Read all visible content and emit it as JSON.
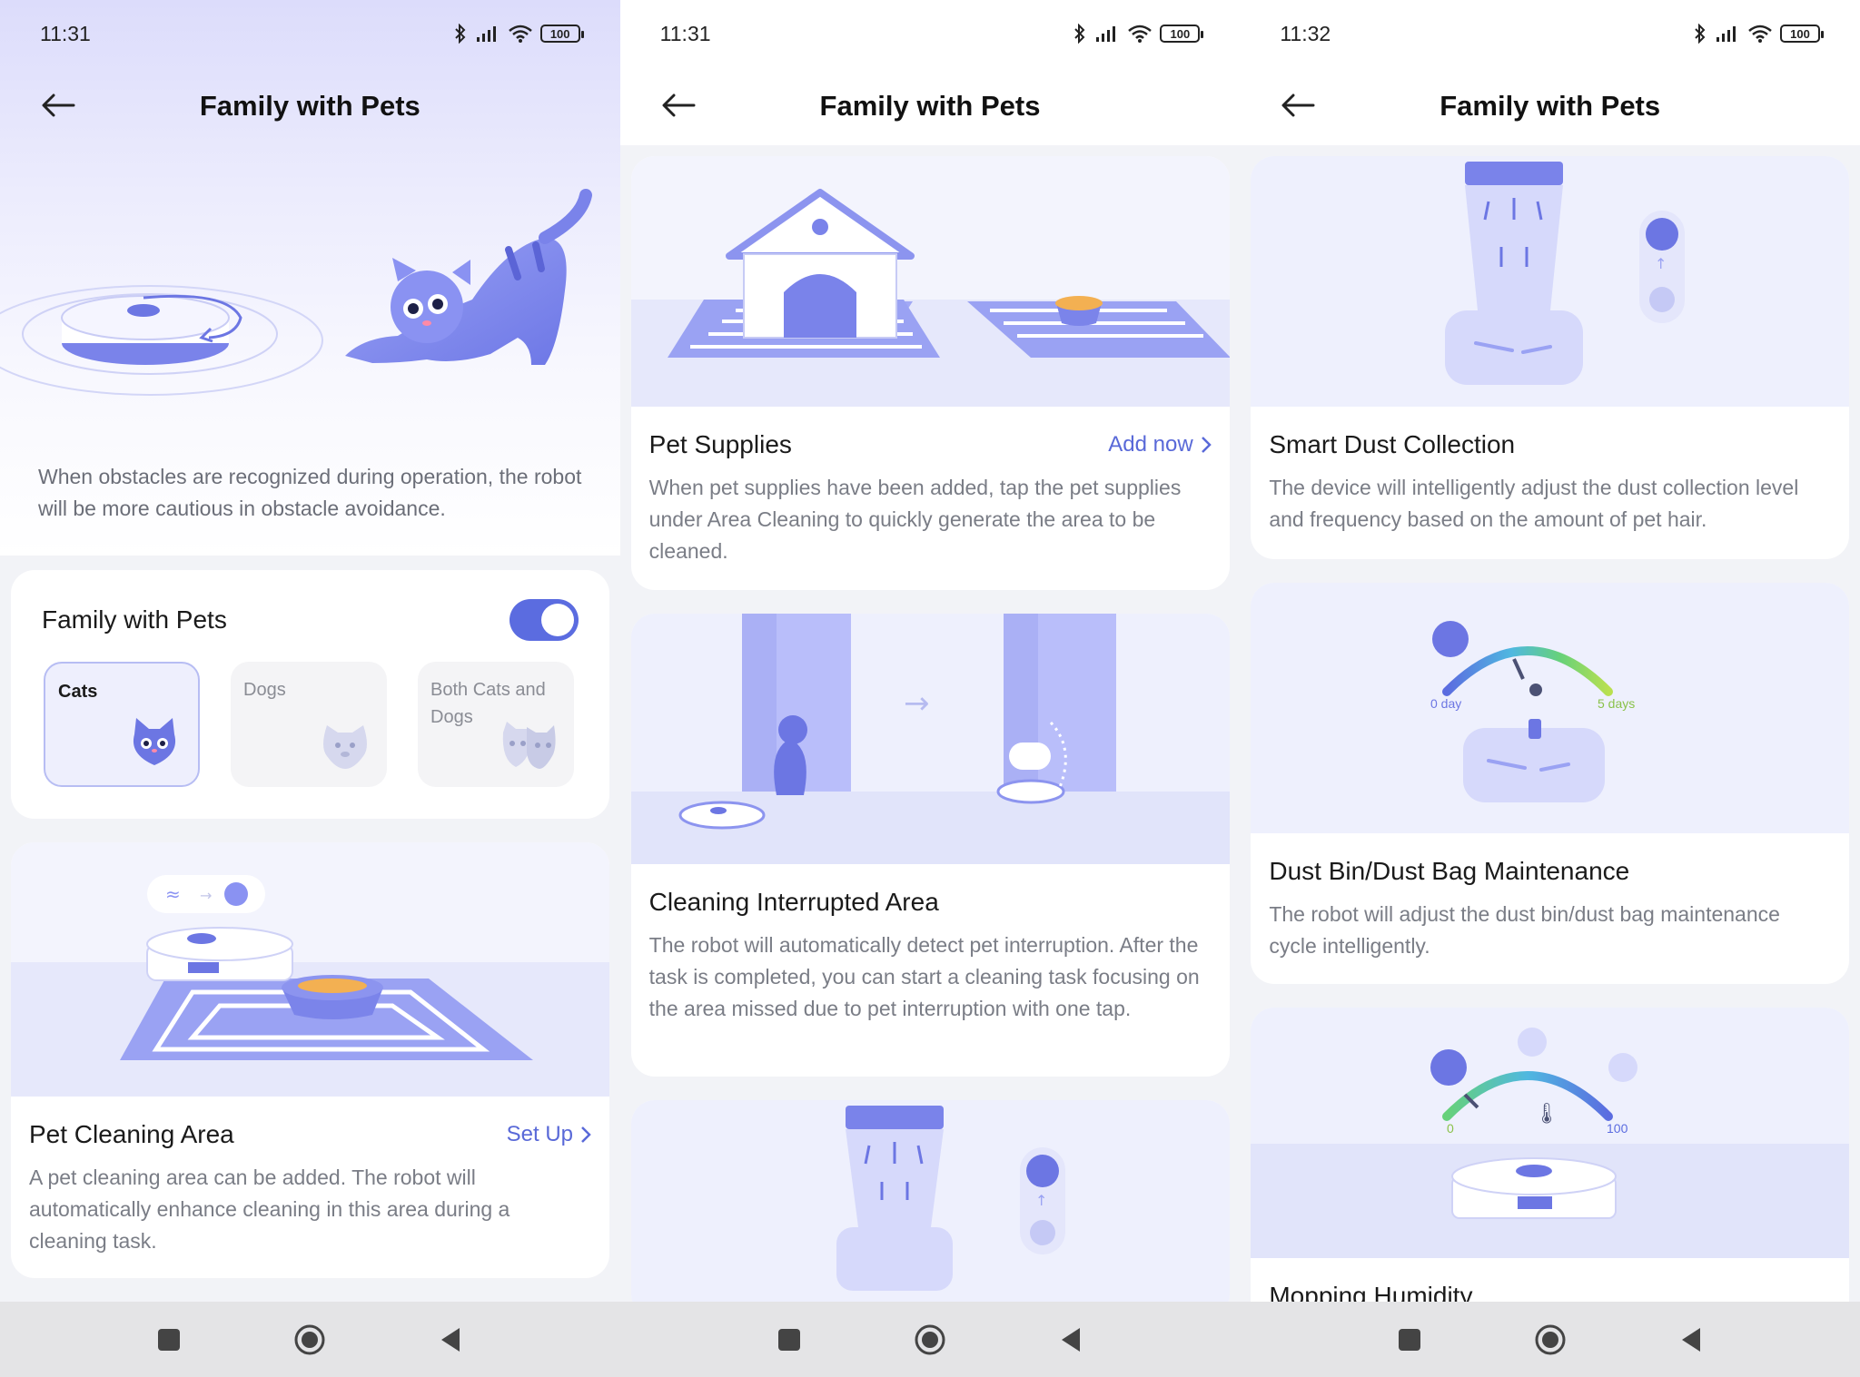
{
  "screens": [
    {
      "status": {
        "time": "11:31",
        "battery": "100"
      },
      "nav": {
        "title": "Family with Pets"
      },
      "hero": {
        "description": "When obstacles are recognized during operation, the robot will be more cautious in obstacle avoidance."
      },
      "toggle_card": {
        "label": "Family with Pets",
        "enabled": true,
        "options": [
          {
            "label": "Cats",
            "selected": true
          },
          {
            "label": "Dogs",
            "selected": false
          },
          {
            "label": "Both Cats and Dogs",
            "selected": false
          }
        ]
      },
      "pet_cleaning": {
        "title": "Pet Cleaning Area",
        "action": "Set Up",
        "description": "A pet cleaning area can be added. The robot will automatically enhance cleaning in this area during a cleaning task."
      }
    },
    {
      "status": {
        "time": "11:31",
        "battery": "100"
      },
      "nav": {
        "title": "Family with Pets"
      },
      "pet_supplies": {
        "title": "Pet Supplies",
        "action": "Add now",
        "description": "When pet supplies have been added, tap the pet supplies under Area Cleaning to quickly generate the area to be cleaned."
      },
      "interrupted": {
        "title": "Cleaning Interrupted Area",
        "description": "The robot will automatically detect pet interruption. After the task is completed, you can start a cleaning task focusing on the area missed due to pet interruption with one tap."
      }
    },
    {
      "status": {
        "time": "11:32",
        "battery": "100"
      },
      "nav": {
        "title": "Family with Pets"
      },
      "dust_collection": {
        "title": "Smart Dust Collection",
        "description": "The device will intelligently adjust the dust collection level and frequency based on the amount of pet hair."
      },
      "dust_bin": {
        "title": "Dust Bin/Dust Bag Maintenance",
        "description": "The robot will adjust the dust bin/dust bag maintenance cycle intelligently.",
        "gauge_min": "0 day",
        "gauge_max": "5 days"
      },
      "mopping": {
        "title": "Mopping Humidity",
        "gauge_min": "0",
        "gauge_max": "100"
      }
    }
  ],
  "colors": {
    "accent": "#5b6ce0",
    "link": "#5969d8",
    "illustration": "#8b93f0",
    "background": "#f2f3f7"
  },
  "icons": [
    "back-arrow-icon",
    "bluetooth-icon",
    "signal-icon",
    "wifi-icon",
    "battery-icon",
    "chevron-right-icon",
    "square-nav-icon",
    "circle-home-icon",
    "triangle-back-icon"
  ]
}
